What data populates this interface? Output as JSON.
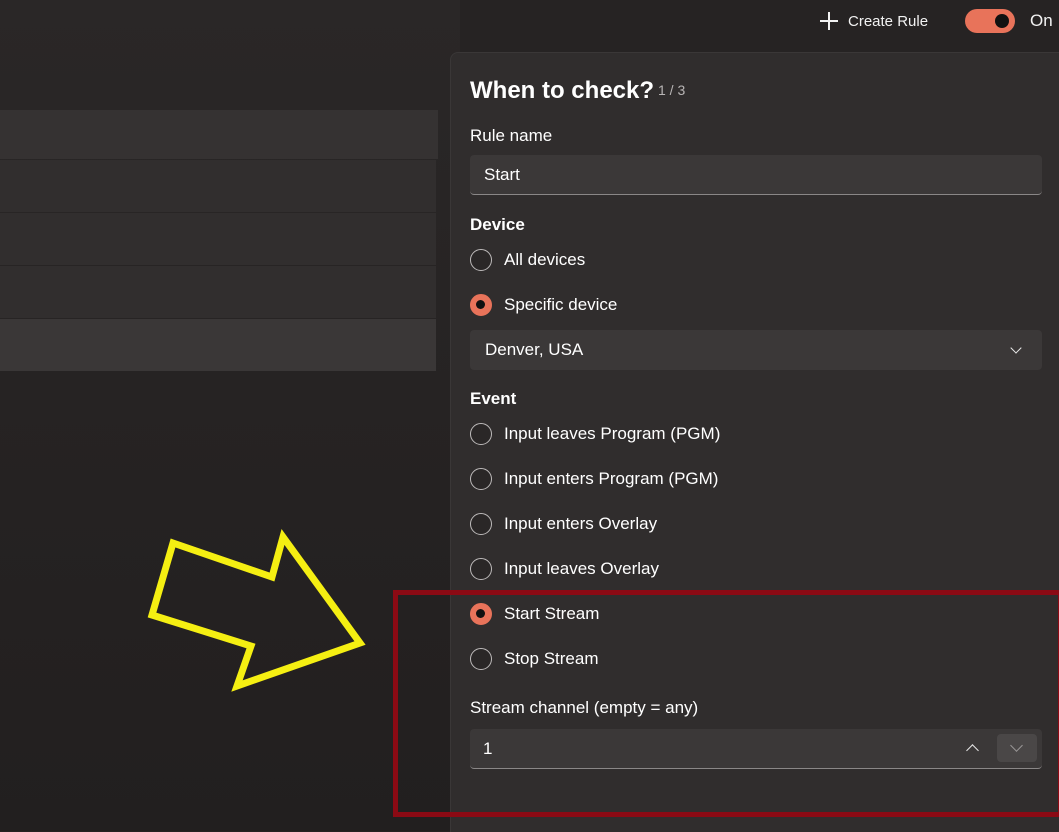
{
  "toolbar": {
    "create_rule_label": "Create Rule",
    "toggle_label": "On",
    "toggle_state": "on"
  },
  "panel": {
    "title": "When to check?",
    "step": "1 / 3",
    "rule_name_label": "Rule name",
    "rule_name_value": "Start",
    "device_label": "Device",
    "device_options": [
      "All devices",
      "Specific device"
    ],
    "device_selected": "Specific device",
    "device_dropdown_value": "Denver, USA",
    "event_label": "Event",
    "event_options": [
      "Input leaves Program (PGM)",
      "Input enters Program (PGM)",
      "Input enters Overlay",
      "Input leaves Overlay",
      "Start Stream",
      "Stop Stream"
    ],
    "event_selected": "Start Stream",
    "stream_channel_label": "Stream channel (empty = any)",
    "stream_channel_value": "1"
  },
  "colors": {
    "accent": "#e8735a",
    "highlight": "#8b0a14",
    "arrow": "#f5ef12"
  }
}
